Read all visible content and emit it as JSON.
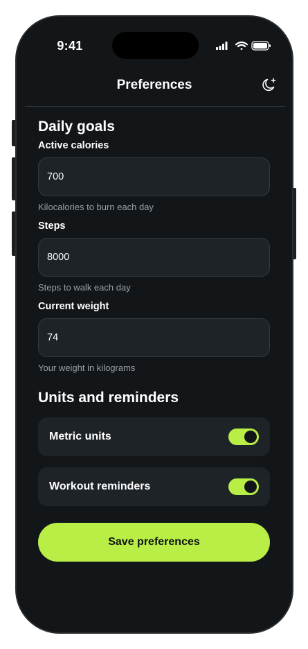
{
  "status_bar": {
    "time": "9:41",
    "icons": [
      "cellular-signal-icon",
      "wifi-icon",
      "battery-icon"
    ]
  },
  "nav": {
    "title": "Preferences",
    "theme_toggle_icon": "moon-sparkle-icon"
  },
  "daily_goals": {
    "title": "Daily goals",
    "fields": [
      {
        "label": "Active calories",
        "value": "700",
        "helper": "Kilocalories to burn each day"
      },
      {
        "label": "Steps",
        "value": "8000",
        "helper": "Steps to walk each day"
      },
      {
        "label": "Current weight",
        "value": "74",
        "helper": "Your weight in kilograms"
      }
    ]
  },
  "units_reminders": {
    "title": "Units and reminders",
    "toggles": [
      {
        "label": "Metric units",
        "on": true
      },
      {
        "label": "Workout reminders",
        "on": true
      }
    ]
  },
  "actions": {
    "save_label": "Save preferences"
  },
  "colors": {
    "background": "#121619",
    "surface": "#1e2328",
    "accent": "#b8ee45",
    "text": "#ffffff",
    "muted_text": "#9aa0a6"
  }
}
